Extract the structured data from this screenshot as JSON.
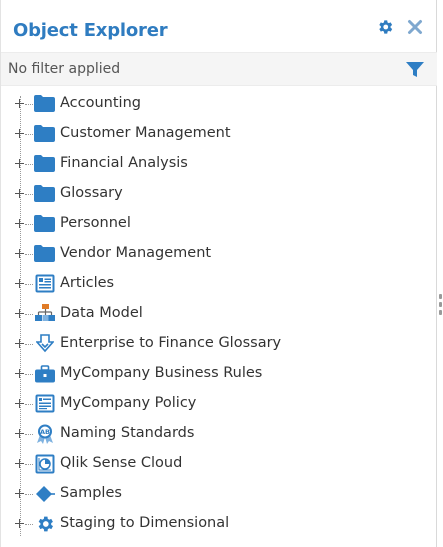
{
  "header": {
    "title": "Object Explorer",
    "settings_icon": "gear-icon",
    "close_icon": "close-icon"
  },
  "filter": {
    "text": "No filter applied",
    "icon": "funnel-icon"
  },
  "colors": {
    "accent": "#2f7cc0",
    "folder": "#2e7ec4",
    "text": "#333333"
  },
  "tree": {
    "items": [
      {
        "label": "Accounting",
        "icon": "folder-icon"
      },
      {
        "label": "Customer Management",
        "icon": "folder-icon"
      },
      {
        "label": "Financial Analysis",
        "icon": "folder-icon"
      },
      {
        "label": "Glossary",
        "icon": "folder-icon"
      },
      {
        "label": "Personnel",
        "icon": "folder-icon"
      },
      {
        "label": "Vendor Management",
        "icon": "folder-icon"
      },
      {
        "label": "Articles",
        "icon": "articles-icon"
      },
      {
        "label": "Data Model",
        "icon": "data-model-icon"
      },
      {
        "label": "Enterprise to Finance Glossary",
        "icon": "mapping-arrow-icon"
      },
      {
        "label": "MyCompany Business Rules",
        "icon": "briefcase-icon"
      },
      {
        "label": "MyCompany Policy",
        "icon": "policy-document-icon"
      },
      {
        "label": "Naming Standards",
        "icon": "ab-badge-icon"
      },
      {
        "label": "Qlik Sense Cloud",
        "icon": "qlik-chart-icon"
      },
      {
        "label": "Samples",
        "icon": "diamond-icon"
      },
      {
        "label": "Staging to Dimensional",
        "icon": "gear-icon"
      }
    ]
  }
}
